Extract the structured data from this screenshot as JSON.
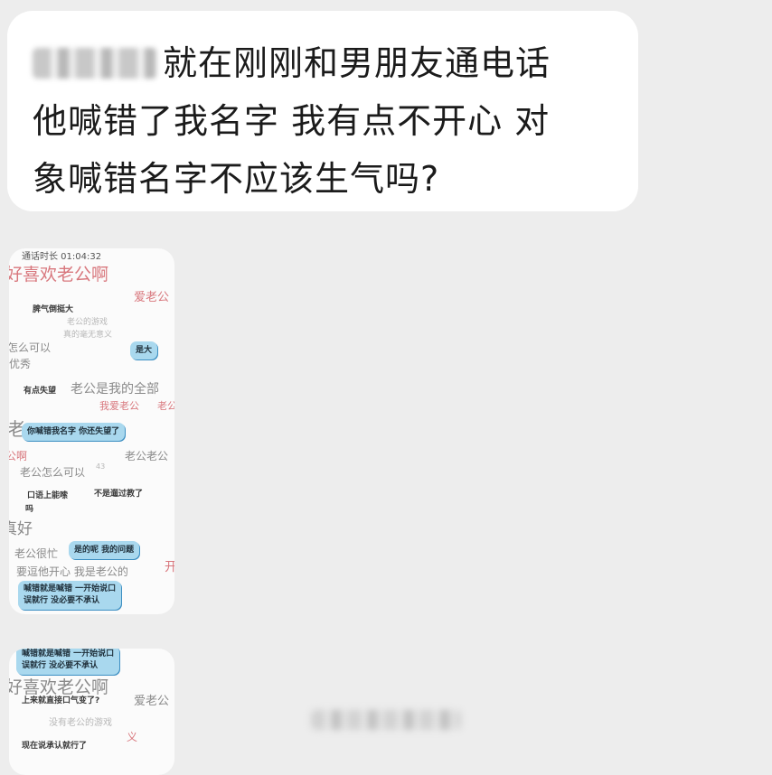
{
  "message": {
    "line1": "就在刚刚和男朋友通电话",
    "line2": "他喊错了我名字 我有点不开心 对",
    "line3": "象喊错名字不应该生气吗?"
  },
  "thumb1": {
    "status": "通话时长 01:04:32",
    "bg": [
      "好喜欢老公啊",
      "爱老公",
      "老公的游戏",
      "真的毫无意义",
      "怎么可以",
      "优秀",
      "老公是我的全部",
      "我爱老公",
      "老公",
      "老",
      "公啊",
      "老公老公",
      "老公怎么可以",
      "43",
      "真好",
      "老公很忙",
      "要逗他开心 我是老公的",
      "开"
    ],
    "dark": [
      "脾气倒挺大",
      "有点失望",
      "口语上能嗦",
      "不是遛过教了",
      "吗"
    ],
    "bubbles": [
      "是大",
      "你喊错我名字 你还失望了",
      "是的呢 我的问题",
      "喊错就是喊错 一开始说口",
      "误就行 没必要不承认"
    ]
  },
  "thumb2": {
    "bubbles": [
      "喊错就是喊错 一开始说口",
      "误就行 没必要不承认"
    ],
    "bg": [
      "好喜欢老公啊",
      "爱老公",
      "没有老公的游戏",
      "义"
    ],
    "dark": [
      "上来就直接口气变了?",
      "现在说承认就行了"
    ]
  }
}
